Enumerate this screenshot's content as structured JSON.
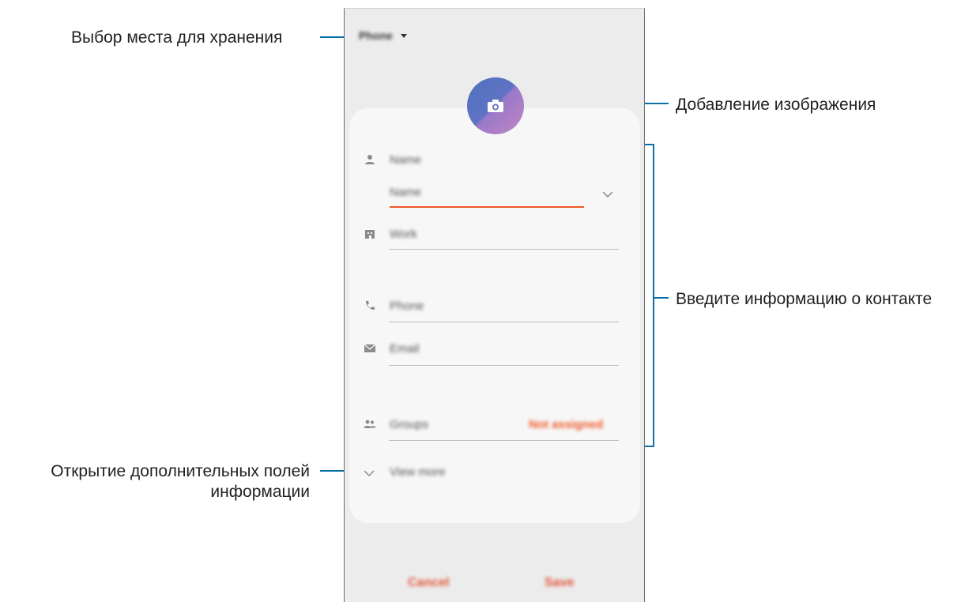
{
  "callouts": {
    "storage": "Выбор места для хранения",
    "image": "Добавление изображения",
    "contact_info": "Введите информацию о контакте",
    "more_fields_line1": "Открытие дополнительных полей",
    "more_fields_line2": "информации"
  },
  "phone": {
    "storage_value": "Phone",
    "fields": {
      "name_label": "Name",
      "name_input": "Name",
      "work": "Work",
      "phone": "Phone",
      "email": "Email",
      "groups": "Groups",
      "groups_value": "Not assigned",
      "view_more": "View more"
    },
    "buttons": {
      "cancel": "Cancel",
      "save": "Save"
    }
  },
  "colors": {
    "accent": "#f05a28",
    "callout_line": "#0b6fa8"
  }
}
